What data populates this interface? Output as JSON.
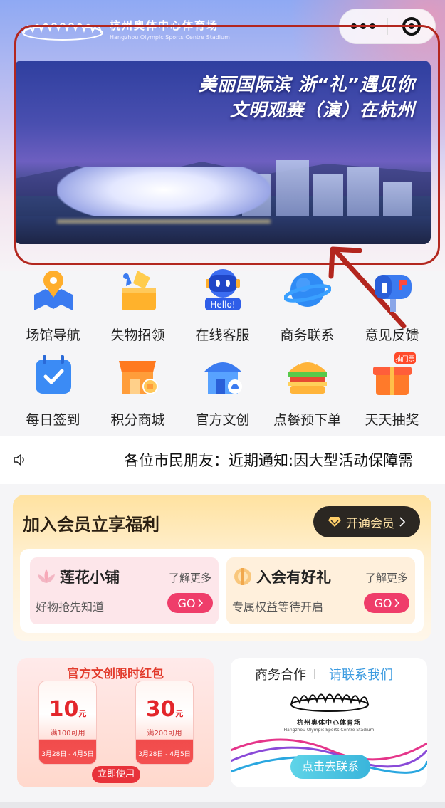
{
  "header": {
    "logo_cn": "杭州奥体中心体育场",
    "logo_en": "Hangzhou Olympic Sports Centre Stadium",
    "more_icon": "more-dots-icon",
    "close_icon": "target-close-icon"
  },
  "banner": {
    "line1": "美丽国际滨 浙“礼”遇见你",
    "line2": "文明观赛（演）在杭州"
  },
  "grid": [
    {
      "label": "场馆导航",
      "icon": "map-pin-icon"
    },
    {
      "label": "失物招领",
      "icon": "lost-found-icon"
    },
    {
      "label": "在线客服",
      "icon": "robot-hello-icon",
      "badge": "Hello!"
    },
    {
      "label": "商务联系",
      "icon": "planet-icon"
    },
    {
      "label": "意见反馈",
      "icon": "mailbox-icon"
    },
    {
      "label": "每日签到",
      "icon": "calendar-check-icon"
    },
    {
      "label": "积分商城",
      "icon": "shop-coin-icon"
    },
    {
      "label": "官方文创",
      "icon": "house-lotus-icon"
    },
    {
      "label": "点餐预下单",
      "icon": "burger-icon"
    },
    {
      "label": "天天抽奖",
      "icon": "gift-icon",
      "badge": "抽门票"
    }
  ],
  "notice": {
    "text": "各位市民朋友：近期通知:因大型活动保障需"
  },
  "member": {
    "title": "加入会员立享福利",
    "button": "开通会员",
    "cards": [
      {
        "title": "莲花小铺",
        "more": "了解更多",
        "sub": "好物抢先知道",
        "go": "GO"
      },
      {
        "title": "入会有好礼",
        "more": "了解更多",
        "sub": "专属权益等待开启",
        "go": "GO"
      }
    ]
  },
  "promo_left": {
    "title": "官方文创限时红包",
    "coupons": [
      {
        "amount": "10",
        "unit": "元",
        "condition": "满100可用",
        "date": "3月28日 - 4月5日"
      },
      {
        "amount": "30",
        "unit": "元",
        "condition": "满200可用",
        "date": "3月28日 - 4月5日"
      }
    ],
    "button": "立即使用"
  },
  "promo_right": {
    "title": "商务合作",
    "link": "请联系我们",
    "logo_cn": "杭州奥体中心体育场",
    "logo_en": "Hangzhou Olympic Sports Centre Stadium",
    "button": "点击去联系"
  },
  "colors": {
    "highlight": "#b3261e",
    "accent_red": "#ef3d6a",
    "link_blue": "#3c9be0"
  }
}
